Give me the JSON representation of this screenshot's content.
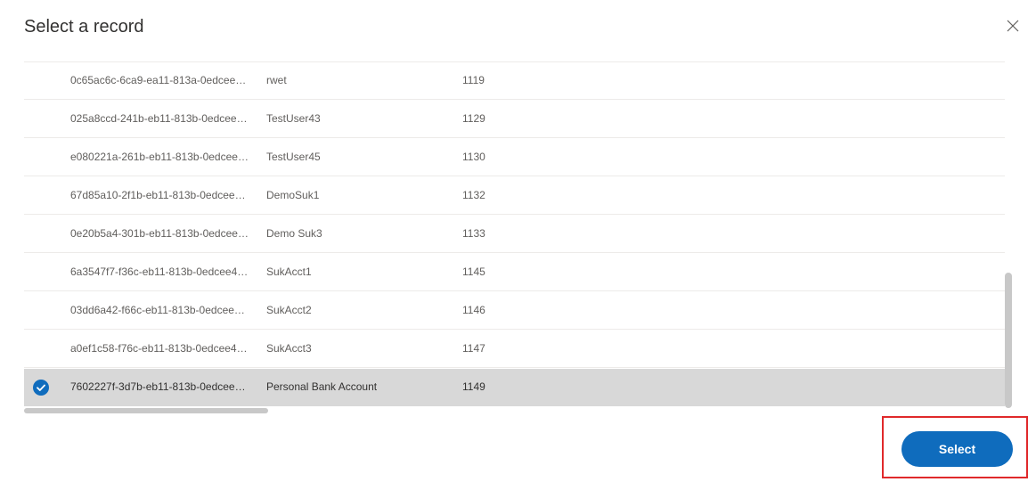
{
  "dialog": {
    "title": "Select a record",
    "close_icon": "close-icon"
  },
  "records": [
    {
      "id": "0c65ac6c-6ca9-ea11-813a-0edcee…",
      "name": "rwet",
      "number": "1119",
      "selected": false
    },
    {
      "id": "025a8ccd-241b-eb11-813b-0edcee…",
      "name": "TestUser43",
      "number": "1129",
      "selected": false
    },
    {
      "id": "e080221a-261b-eb11-813b-0edcee…",
      "name": "TestUser45",
      "number": "1130",
      "selected": false
    },
    {
      "id": "67d85a10-2f1b-eb11-813b-0edcee…",
      "name": "DemoSuk1",
      "number": "1132",
      "selected": false
    },
    {
      "id": "0e20b5a4-301b-eb11-813b-0edcee…",
      "name": "Demo Suk3",
      "number": "1133",
      "selected": false
    },
    {
      "id": "6a3547f7-f36c-eb11-813b-0edcee4…",
      "name": "SukAcct1",
      "number": "1145",
      "selected": false
    },
    {
      "id": "03dd6a42-f66c-eb11-813b-0edcee…",
      "name": "SukAcct2",
      "number": "1146",
      "selected": false
    },
    {
      "id": "a0ef1c58-f76c-eb11-813b-0edcee4…",
      "name": "SukAcct3",
      "number": "1147",
      "selected": false
    },
    {
      "id": "7602227f-3d7b-eb11-813b-0edcee…",
      "name": "Personal Bank Account",
      "number": "1149",
      "selected": true
    }
  ],
  "footer": {
    "select_label": "Select"
  },
  "colors": {
    "accent": "#0f6cbd",
    "selected_row": "#d8d8d8",
    "highlight_border": "#e0292b"
  }
}
